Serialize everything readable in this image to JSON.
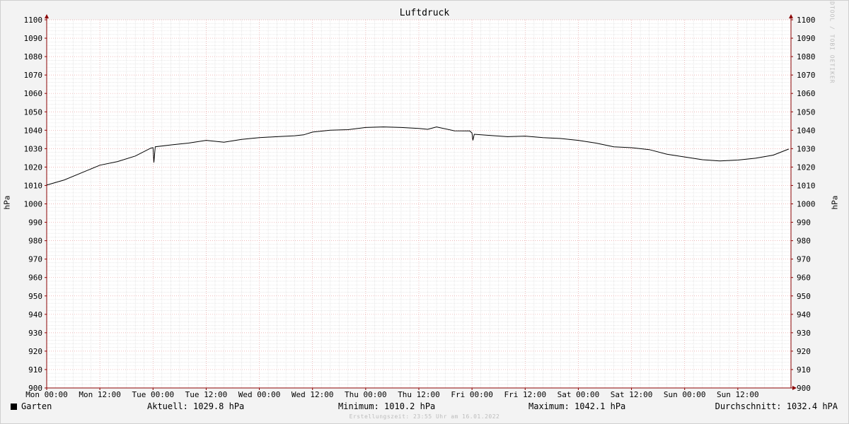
{
  "chart_data": {
    "type": "line",
    "title": "Luftdruck",
    "ylabel": "hPa",
    "ylim": [
      900,
      1100
    ],
    "y_ticks": [
      900,
      910,
      920,
      930,
      940,
      950,
      960,
      970,
      980,
      990,
      1000,
      1010,
      1020,
      1030,
      1040,
      1050,
      1060,
      1070,
      1080,
      1090,
      1100
    ],
    "x_ticks": [
      "Mon 00:00",
      "Mon 12:00",
      "Tue 00:00",
      "Tue 12:00",
      "Wed 00:00",
      "Wed 12:00",
      "Thu 00:00",
      "Thu 12:00",
      "Fri 00:00",
      "Fri 12:00",
      "Sat 00:00",
      "Sat 12:00",
      "Sun 00:00",
      "Sun 12:00"
    ],
    "grid": true,
    "legend_position": "bottom-left",
    "series": [
      {
        "name": "Garten",
        "color": "#000000",
        "x_hours": [
          0,
          4,
          8,
          12,
          16,
          20,
          23.5,
          24,
          24.2,
          24.5,
          28,
          32,
          36,
          40,
          44,
          48,
          52,
          56,
          58,
          60,
          64,
          68,
          72,
          76,
          80,
          84,
          86,
          88,
          92,
          95.5,
          96,
          96.2,
          96.5,
          100,
          104,
          108,
          112,
          116,
          120,
          124,
          128,
          132,
          136,
          140,
          144,
          148,
          152,
          156,
          160,
          164,
          167.5
        ],
        "values": [
          1010.2,
          1013,
          1017,
          1021,
          1023,
          1026,
          1030.3,
          1030.5,
          1022.5,
          1031,
          1032,
          1033,
          1034.5,
          1033.5,
          1035,
          1036,
          1036.5,
          1037,
          1037.5,
          1039,
          1040,
          1040.3,
          1041.5,
          1041.8,
          1041.5,
          1041,
          1040.5,
          1041.8,
          1039.7,
          1039.6,
          1038.5,
          1034.5,
          1037.8,
          1037.2,
          1036.5,
          1036.8,
          1036,
          1035.5,
          1034.5,
          1033,
          1031,
          1030.5,
          1029.5,
          1027,
          1025.5,
          1024,
          1023.3,
          1023.8,
          1024.8,
          1026.5,
          1029.8
        ]
      }
    ]
  },
  "legend": {
    "series_name": "Garten",
    "current": "Aktuell: 1029.8 hPa",
    "minimum": "Minimum: 1010.2 hPa",
    "maximum": "Maximum: 1042.1 hPa",
    "average": "Durchschnitt: 1032.4 hPA"
  },
  "watermark": "RRDTOOL / TOBI OETIKER",
  "footer": "Erstellungszeit: 23:55 Uhr am 16.01.2022",
  "colors": {
    "background": "#f3f3f3",
    "plot_background": "#ffffff",
    "minor_grid": "#d9d9d9",
    "major_grid": "#e8a0a0",
    "axis": "#8b0000",
    "line": "#000000"
  }
}
